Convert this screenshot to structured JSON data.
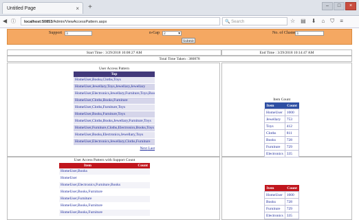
{
  "browser": {
    "tab_title": "Untitled Page",
    "tab_close": "×",
    "new_tab": "+",
    "url_host": "localhost:50853",
    "url_path": "/Admin/ViewAccessPattern.aspx",
    "search_placeholder": "Search"
  },
  "form": {
    "support_label": "Support",
    "support_value": "3",
    "ngap_label": "n-Gap",
    "ngap_value": "2",
    "clusters_label": "No. of Cluster",
    "clusters_value": "3",
    "submit_label": "Submit"
  },
  "times": {
    "start": "Start Time : 3/29/2018 10:08:27 AM",
    "end": "End Time : 3/29/2018 10:14:47 AM",
    "total": "Total Time Taken : 380878"
  },
  "pattern": {
    "title": "User Access Pattern",
    "header": "Top",
    "rows": [
      "HomeUser,Books,Cloths,Toys",
      "HomeUser,Jewellary,Toys,Jewellary,Jewellary",
      "HomeUser,Electronics,Jewellary,Furniture,Toys,Books",
      "HomeUser,Cloths,Books,Furniture",
      "HomeUser,Cloths,Furniture,Toys",
      "HomeUser,Books,Furniture,Toys",
      "HomeUser,Cloths,Books,Jewellary,Furniture,Toys",
      "HomeUser,Furniture,Cloths,Electronics,Books,Toys",
      "HomeUser,Books,Electronics,Jewellary,Toys",
      "HomeUser,Electronics,Jewellary,Cloths,Furniture"
    ],
    "next": "Next",
    "last": "Last"
  },
  "item_count": {
    "title": "Item Count",
    "col_item": "Item",
    "col_count": "Count",
    "rows": [
      {
        "item": "HomeUser",
        "count": "1000"
      },
      {
        "item": "Jewellary",
        "count": "753"
      },
      {
        "item": "Toys",
        "count": "412"
      },
      {
        "item": "Cloths",
        "count": "811"
      },
      {
        "item": "Books",
        "count": "728"
      },
      {
        "item": "Furniture",
        "count": "729"
      },
      {
        "item": "Electronics",
        "count": "335"
      }
    ]
  },
  "support_pattern": {
    "title": "User Access Pattern with Support Count",
    "col_item": "Item",
    "col_count": "Count",
    "rows": [
      "HomeUser,Books",
      "HomeUser",
      "HomeUser,Electronics,Furniture,Books",
      "HomeUser,Books,Furniture",
      "HomeUser,Furniture",
      "HomeUser,Books,Furniture",
      "HomeUser,Books,Furniture"
    ]
  },
  "item_count2": {
    "col_item": "Item",
    "col_count": "Count",
    "rows": [
      {
        "item": "HomeUser",
        "count": "1000"
      },
      {
        "item": "Books",
        "count": "728"
      },
      {
        "item": "Furniture",
        "count": "729"
      },
      {
        "item": "Electronics",
        "count": "335"
      }
    ]
  },
  "colors": {
    "orange_bar": "#f5a862",
    "pattern_header": "#42397a",
    "item_header_blue": "#2e4fa3",
    "item_header_red": "#c0161d",
    "link": "#1d2a9c"
  }
}
